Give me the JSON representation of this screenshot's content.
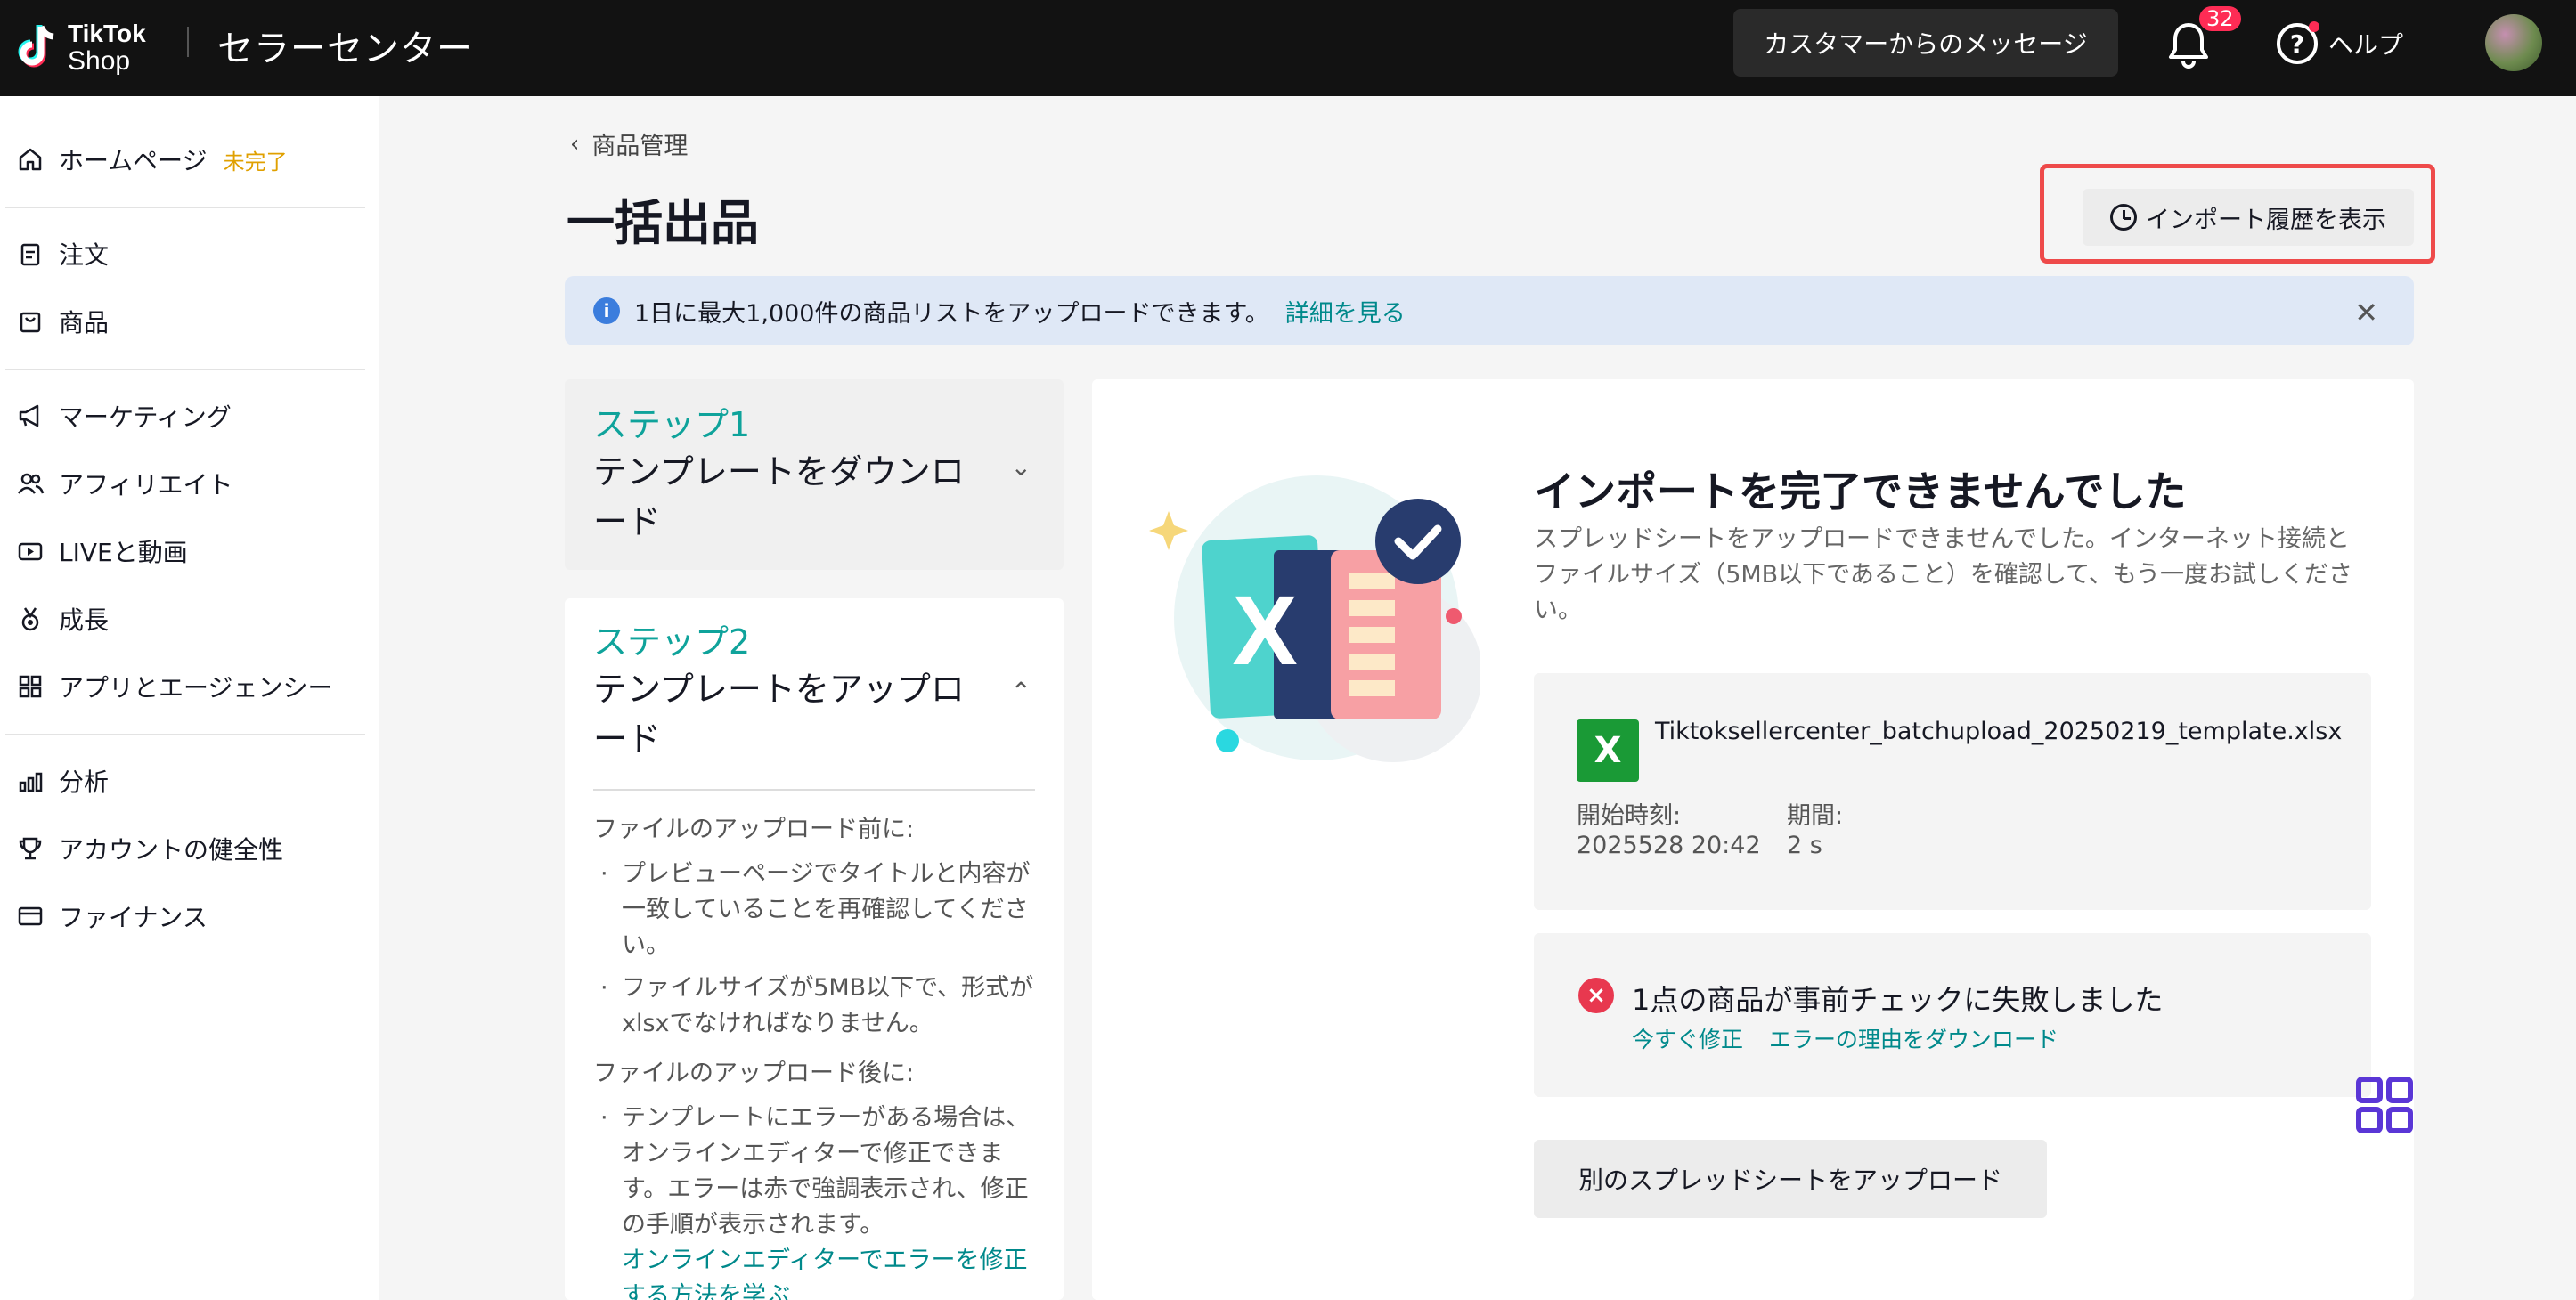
{
  "header": {
    "logo_line1": "TikTok",
    "logo_line2": "Shop",
    "title": "セラーセンター",
    "messages_button": "カスタマーからのメッセージ",
    "notification_count": "32",
    "help_label": "ヘルプ"
  },
  "sidebar": {
    "items": [
      {
        "label": "ホームページ",
        "tag": "未完了",
        "icon": "home-icon"
      },
      {
        "label": "注文",
        "icon": "clipboard-icon"
      },
      {
        "label": "商品",
        "icon": "bag-icon"
      },
      {
        "label": "マーケティング",
        "icon": "megaphone-icon"
      },
      {
        "label": "アフィリエイト",
        "icon": "people-icon"
      },
      {
        "label": "LIVEと動画",
        "icon": "video-icon"
      },
      {
        "label": "成長",
        "icon": "medal-icon"
      },
      {
        "label": "アプリとエージェンシー",
        "icon": "apps-icon"
      },
      {
        "label": "分析",
        "icon": "chart-icon"
      },
      {
        "label": "アカウントの健全性",
        "icon": "trophy-icon"
      },
      {
        "label": "ファイナンス",
        "icon": "card-icon"
      }
    ]
  },
  "page": {
    "breadcrumb": "商品管理",
    "title": "一括出品",
    "history_button": "インポート履歴を表示"
  },
  "banner": {
    "text": "1日に最大1,000件の商品リストをアップロードできます。",
    "link": "詳細を見る"
  },
  "steps": {
    "step1": {
      "num": "ステップ1",
      "title": "テンプレートをダウンロード"
    },
    "step2": {
      "num": "ステップ2",
      "title": "テンプレートをアップロード",
      "before_heading": "ファイルのアップロード前に:",
      "before_items": [
        "プレビューページでタイトルと内容が一致していることを再確認してください。",
        "ファイルサイズが5MB以下で、形式がxlsxでなければなりません。"
      ],
      "after_heading": "ファイルのアップロード後に:",
      "after_items": [
        "テンプレートにエラーがある場合は、オンラインエディターで修正できます。エラーは赤で強調表示され、修正の手順が表示されます。"
      ],
      "after_link": "オンラインエディターでエラーを修正する方法を学ぶ"
    }
  },
  "result": {
    "title": "インポートを完了できませんでした",
    "description": "スプレッドシートをアップロードできませんでした。インターネット接続とファイルサイズ（5MB以下であること）を確認して、もう一度お試しください。",
    "file_icon_letter": "X",
    "file_name": "Tiktoksellercenter_batchupload_20250219_template.xlsx",
    "start_label": "開始時刻:",
    "start_value": "2025528 20:42",
    "duration_label": "期間:",
    "duration_value": "2 s",
    "error_icon": "×",
    "error_title": "1点の商品が事前チェックに失敗しました",
    "fix_link": "今すぐ修正",
    "download_link": "エラーの理由をダウンロード",
    "upload_button": "別のスプレッドシートをアップロード"
  },
  "colors": {
    "accent": "#00898b",
    "step_teal": "#0fa39b",
    "error_red": "#e8384f",
    "highlight_red": "#ee4a4a",
    "banner_bg": "#dfe8f6"
  }
}
